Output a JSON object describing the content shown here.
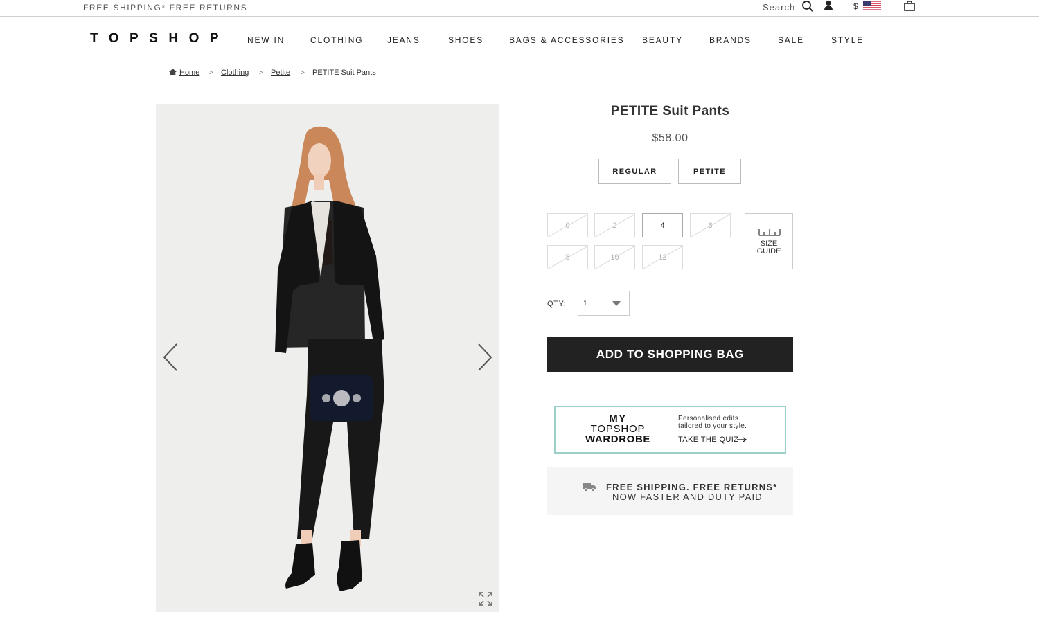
{
  "topbar": {
    "promo": "FREE SHIPPING* FREE RETURNS",
    "search_label": "Search",
    "currency": "$",
    "icons": [
      "search-icon",
      "account-icon",
      "us-flag-icon",
      "shopping-bag-icon"
    ]
  },
  "header": {
    "logo": "TOPSHOP",
    "nav": [
      "NEW IN",
      "CLOTHING",
      "JEANS",
      "SHOES",
      "BAGS & ACCESSORIES",
      "BEAUTY",
      "BRANDS",
      "SALE",
      "STYLE"
    ]
  },
  "breadcrumb": {
    "items": [
      "Home",
      "Clothing",
      "Petite"
    ],
    "separator": ">",
    "current": "PETITE Suit Pants"
  },
  "gallery": {
    "icons": [
      "chevron-left-icon",
      "chevron-right-icon",
      "expand-icon"
    ]
  },
  "product": {
    "title": "PETITE Suit Pants",
    "price": "$58.00",
    "fit_options": [
      "REGULAR",
      "PETITE"
    ],
    "sizes": [
      {
        "label": "0",
        "available": false
      },
      {
        "label": "2",
        "available": false
      },
      {
        "label": "4",
        "available": true
      },
      {
        "label": "6",
        "available": false
      },
      {
        "label": "8",
        "available": false
      },
      {
        "label": "10",
        "available": false
      },
      {
        "label": "12",
        "available": false
      }
    ],
    "size_guide_label": "SIZE\nGUIDE",
    "qty_label": "QTY:",
    "qty_value": "1",
    "add_to_bag": "ADD TO SHOPPING BAG"
  },
  "wardrobe_promo": {
    "logo_line1": "MY",
    "logo_line2": "TOPSHOP",
    "logo_line3": "WARDROBE",
    "text": "Personalised edits\ntailored to your style.",
    "cta": "TAKE THE QUIZ"
  },
  "shipping_promo": {
    "line1": "FREE SHIPPING. FREE RETURNS*",
    "line2": "NOW FASTER AND DUTY PAID"
  },
  "colors": {
    "button_dark": "#222222",
    "wardrobe_border": "#9ad0c7",
    "shipping_bg": "#f5f5f5"
  }
}
